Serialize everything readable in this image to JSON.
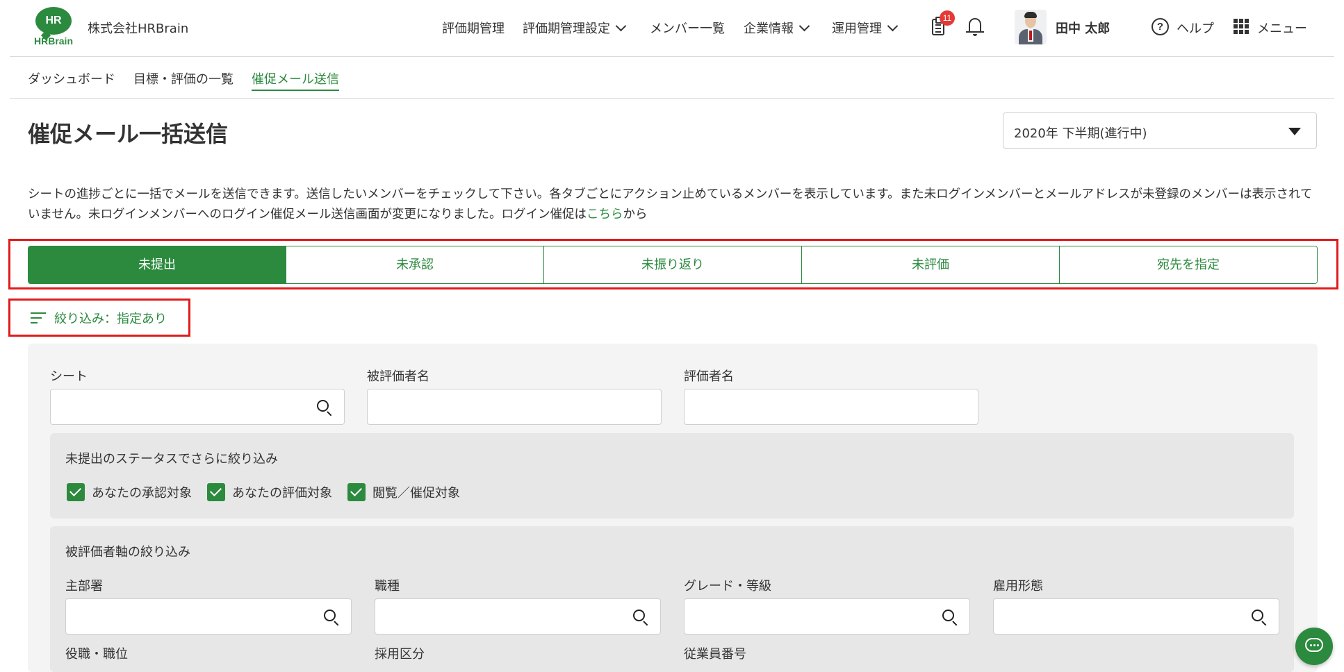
{
  "header": {
    "logo_text": "HR",
    "logo_brand": "HRBrain",
    "company": "株式会社HRBrain",
    "nav": [
      {
        "label": "評価期管理"
      },
      {
        "label": "評価期管理設定"
      },
      {
        "label": "メンバー一覧"
      },
      {
        "label": "企業情報"
      },
      {
        "label": "運用管理"
      }
    ],
    "notification_count": "11",
    "user_name": "田中 太郎",
    "help_label": "ヘルプ",
    "menu_label": "メニュー"
  },
  "breadcrumb": [
    "ダッシュボード",
    "目標・評価の一覧",
    "催促メール送信"
  ],
  "page": {
    "title": "催促メール一括送信",
    "period": "2020年 下半期(進行中)",
    "description_1": "シートの進捗ごとに一括でメールを送信できます。送信したいメンバーをチェックして下さい。各タブごとにアクション止めているメンバーを表示しています。また未ログインメンバーとメールアドレスが未登録のメンバ",
    "description_2": "ーは表示されていません。未ログインメンバーへのログイン催促メール送信画面が変更になりました。ログイン催促は",
    "description_link": "こちら",
    "description_3": "から"
  },
  "tabs": [
    {
      "label": "未提出",
      "active": true
    },
    {
      "label": "未承認",
      "active": false
    },
    {
      "label": "未振り返り",
      "active": false
    },
    {
      "label": "未評価",
      "active": false
    },
    {
      "label": "宛先を指定",
      "active": false
    }
  ],
  "filter": {
    "toggle_label": "絞り込み：指定あり",
    "sheet_label": "シート",
    "evaluatee_label": "被評価者名",
    "evaluator_label": "評価者名",
    "status_section_title": "未提出のステータスでさらに絞り込み",
    "status_checks": [
      {
        "label": "あなたの承認対象",
        "checked": true
      },
      {
        "label": "あなたの評価対象",
        "checked": true
      },
      {
        "label": "閲覧／催促対象",
        "checked": true
      }
    ],
    "axis_section_title": "被評価者軸の絞り込み",
    "fields": [
      "主部署",
      "職種",
      "グレード・等級",
      "雇用形態",
      "役職・職位",
      "採用区分",
      "従業員番号"
    ]
  },
  "colors": {
    "brand_green": "#2b8a3e",
    "highlight_red": "#e21a1a",
    "badge_red": "#e53935"
  }
}
